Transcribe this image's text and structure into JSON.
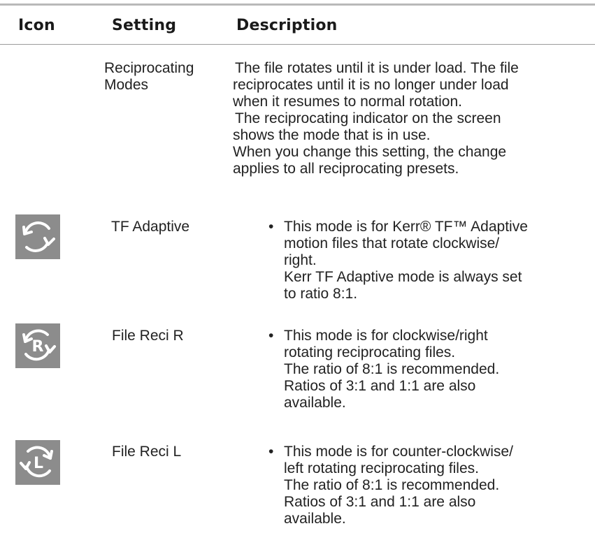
{
  "header": {
    "icon": "Icon",
    "setting": "Setting",
    "description": "Description"
  },
  "rows": [
    {
      "icon": null,
      "setting_lines": [
        "Reciprocating",
        "Modes"
      ],
      "description_lines": [
        "The file rotates until it is under load. The file",
        "reciprocates until it is no longer under load",
        "when it resumes to normal rotation.",
        "The reciprocating indicator on the screen",
        "shows the mode that is in use.",
        "When you change this setting, the change",
        "applies to all reciprocating presets."
      ]
    },
    {
      "icon": "rotate-clockwise-icon",
      "setting_lines": [
        "TF Adaptive"
      ],
      "bullet": "•",
      "description_lines": [
        "This mode is for Kerr® TF™ Adaptive",
        "motion files that rotate clockwise/",
        "right.",
        "Kerr TF Adaptive mode is always set",
        "to ratio 8:1."
      ]
    },
    {
      "icon": "reciprocate-right-icon",
      "icon_letter": "R",
      "setting_lines": [
        "File Reci R"
      ],
      "bullet": "•",
      "description_lines": [
        "This mode is for clockwise/right",
        "rotating reciprocating files.",
        "The ratio of 8:1 is recommended.",
        "Ratios of 3:1 and 1:1 are also",
        "available."
      ]
    },
    {
      "icon": "reciprocate-left-icon",
      "icon_letter": "L",
      "setting_lines": [
        "File Reci L"
      ],
      "bullet": "•",
      "description_lines": [
        "This mode is for counter-clockwise/",
        "left rotating reciprocating files.",
        "The ratio of 8:1 is recommended.",
        "Ratios of 3:1 and 1:1 are also",
        "available."
      ]
    }
  ],
  "colors": {
    "icon_background": "#8c8c8c",
    "icon_stroke": "#ffffff",
    "rule": "#b9b9b9"
  }
}
